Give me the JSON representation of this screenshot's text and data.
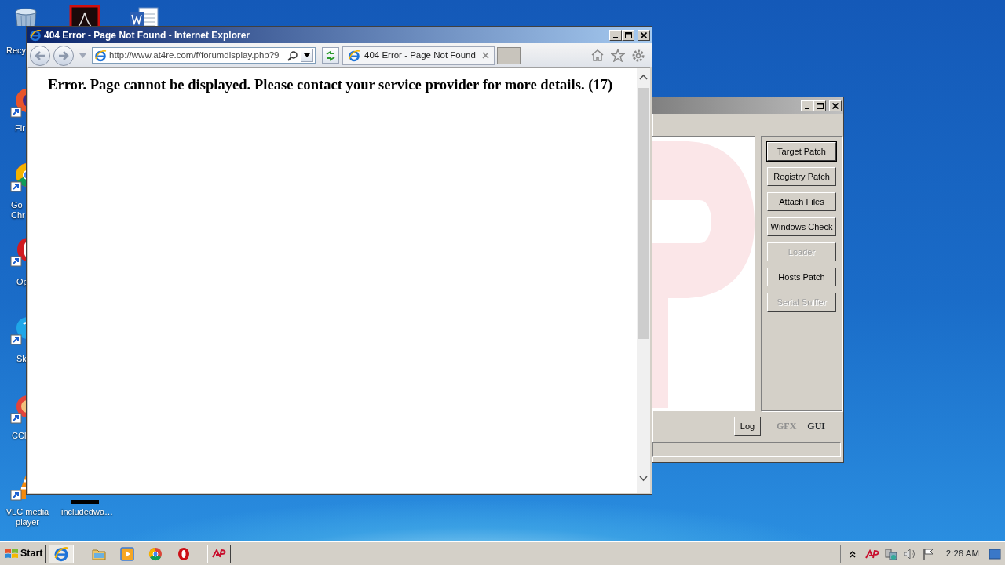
{
  "desktop_icons": [
    {
      "kind": "trash",
      "lines": [
        "Recy"
      ]
    },
    {
      "kind": "pdf"
    },
    {
      "kind": "word"
    },
    {
      "kind": "firefox",
      "lines": [
        "Fir"
      ]
    },
    {
      "kind": "chrome",
      "lines": [
        "Go",
        "Chr"
      ]
    },
    {
      "kind": "opera",
      "lines": [
        "Op"
      ]
    },
    {
      "kind": "skype",
      "lines": [
        "Sk"
      ]
    },
    {
      "kind": "ccleaner",
      "lines": [
        "CCl"
      ]
    },
    {
      "kind": "vlc",
      "lines": [
        "VLC media",
        "player"
      ]
    },
    {
      "kind": "blackfile",
      "lines": [
        "includedwa…"
      ]
    }
  ],
  "patcher_window": {
    "buttons": [
      {
        "label": "Target Patch",
        "disabled": false,
        "default": true
      },
      {
        "label": "Registry Patch",
        "disabled": false,
        "default": false
      },
      {
        "label": "Attach Files",
        "disabled": false,
        "default": false
      },
      {
        "label": "Windows Check",
        "disabled": false,
        "default": false
      },
      {
        "label": "Loader",
        "disabled": true,
        "default": false
      },
      {
        "label": "Hosts Patch",
        "disabled": false,
        "default": false
      },
      {
        "label": "Serial Sniffer",
        "disabled": true,
        "default": false
      }
    ],
    "log_button": "Log",
    "modes": [
      {
        "label": "GFX",
        "disabled": true
      },
      {
        "label": "GUI",
        "disabled": false
      }
    ]
  },
  "ie_window": {
    "title": "404 Error - Page Not Found - Internet Explorer",
    "address": "http://www.at4re.com/f/forumdisplay.php?9",
    "tabs": [
      {
        "label": "404 Error - Page Not Found",
        "selected": true
      }
    ],
    "message": "Error. Page cannot be displayed. Please contact your service provider for more details. (17)"
  },
  "taskbar": {
    "start": "Start",
    "apps": [
      {
        "kind": "ie",
        "active": true
      },
      {
        "kind": "folder",
        "active": false
      },
      {
        "kind": "media",
        "active": false
      },
      {
        "kind": "chrome",
        "active": false
      },
      {
        "kind": "opera",
        "active": false
      },
      {
        "kind": "ap",
        "active": false
      }
    ],
    "tray": [
      {
        "kind": "chevron"
      },
      {
        "kind": "ap"
      },
      {
        "kind": "network"
      },
      {
        "kind": "volume"
      },
      {
        "kind": "flag"
      }
    ],
    "clock": "2:26 AM"
  }
}
